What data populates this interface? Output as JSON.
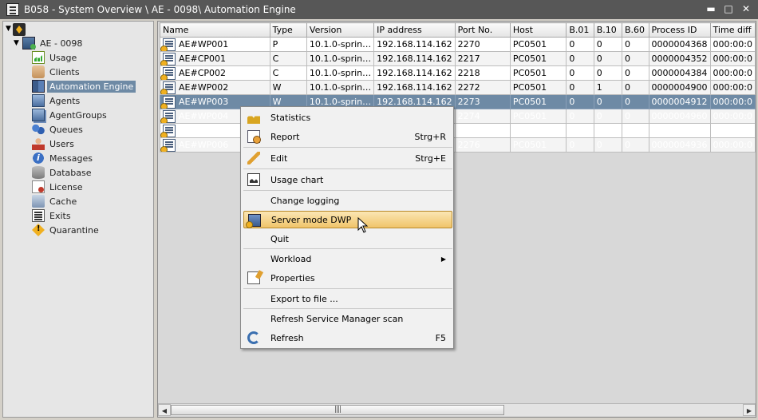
{
  "window": {
    "title": "B058 - System Overview \\ AE - 0098\\ Automation Engine",
    "minimize_glyph": "▬",
    "maximize_glyph": "□",
    "close_glyph": "✕"
  },
  "tree": {
    "root_expander": "▼",
    "system_expander": "▼",
    "system_label": "AE - 0098",
    "items": [
      {
        "label": "Usage",
        "icon": "usage-icon"
      },
      {
        "label": "Clients",
        "icon": "clients-icon"
      },
      {
        "label": "Automation Engine",
        "icon": "automation-engine-icon",
        "selected": true
      },
      {
        "label": "Agents",
        "icon": "agents-icon"
      },
      {
        "label": "AgentGroups",
        "icon": "agentgroups-icon"
      },
      {
        "label": "Queues",
        "icon": "queues-icon"
      },
      {
        "label": "Users",
        "icon": "users-icon"
      },
      {
        "label": "Messages",
        "icon": "messages-icon"
      },
      {
        "label": "Database",
        "icon": "database-icon"
      },
      {
        "label": "License",
        "icon": "license-icon"
      },
      {
        "label": "Cache",
        "icon": "cache-icon"
      },
      {
        "label": "Exits",
        "icon": "exits-icon"
      },
      {
        "label": "Quarantine",
        "icon": "quarantine-icon"
      }
    ]
  },
  "grid": {
    "columns": [
      "Name",
      "Type",
      "Version",
      "IP address",
      "Port No.",
      "Host",
      "B.01",
      "B.10",
      "B.60",
      "Process ID",
      "Time diff"
    ],
    "rows": [
      [
        "AE#WP001",
        "P",
        "10.1.0-sprin…",
        "192.168.114.162",
        "2270",
        "PC0501",
        "0",
        "0",
        "0",
        "0000004368",
        "000:00:0"
      ],
      [
        "AE#CP001",
        "C",
        "10.1.0-sprin…",
        "192.168.114.162",
        "2217",
        "PC0501",
        "0",
        "0",
        "0",
        "0000004352",
        "000:00:0"
      ],
      [
        "AE#CP002",
        "C",
        "10.1.0-sprin…",
        "192.168.114.162",
        "2218",
        "PC0501",
        "0",
        "0",
        "0",
        "0000004384",
        "000:00:0"
      ],
      [
        "AE#WP002",
        "W",
        "10.1.0-sprin…",
        "192.168.114.162",
        "2272",
        "PC0501",
        "0",
        "1",
        "0",
        "0000004900",
        "000:00:0"
      ],
      [
        "AE#WP003",
        "W",
        "10.1.0-sprin…",
        "192.168.114.162",
        "2273",
        "PC0501",
        "0",
        "0",
        "0",
        "0000004912",
        "000:00:0"
      ],
      [
        "AE#WP004",
        "W",
        "10.1.0-sprin…",
        "192.168.114.162",
        "2274",
        "PC0501",
        "0",
        "0",
        "0",
        "0000004960",
        "000:00:0"
      ],
      [
        "AE#WP005",
        "W",
        "10.1.0-sprin…",
        "192.168.114.162",
        "2275",
        "PC0501",
        "0",
        "0",
        "0",
        "0000004948",
        "000:00:0"
      ],
      [
        "AE#WP006",
        "W",
        "10.1.0-sprin…",
        "192.168.114.162",
        "2276",
        "PC0501",
        "0",
        "0",
        "0",
        "0000004936",
        "000:00:0"
      ]
    ],
    "selected_row": 4,
    "scroll_left": "◀",
    "scroll_right": "▶",
    "scroll_grip": "||||"
  },
  "context_menu": {
    "items": [
      {
        "label": "Statistics",
        "shortcut": "",
        "icon": "statistics-icon"
      },
      {
        "label": "Report",
        "shortcut": "Strg+R",
        "icon": "report-icon"
      },
      {
        "label": "Edit",
        "shortcut": "Strg+E",
        "icon": "edit-icon"
      },
      {
        "label": "Usage chart",
        "shortcut": "",
        "icon": "usage-chart-icon"
      },
      {
        "label": "Change logging",
        "shortcut": "",
        "icon": ""
      },
      {
        "label": "Server mode DWP",
        "shortcut": "",
        "icon": "server-mode-icon",
        "highlighted": true
      },
      {
        "label": "Quit",
        "shortcut": "",
        "icon": ""
      },
      {
        "label": "Workload",
        "shortcut": "",
        "icon": "",
        "submenu": "▶"
      },
      {
        "label": "Properties",
        "shortcut": "",
        "icon": "properties-icon"
      },
      {
        "label": "Export to file ...",
        "shortcut": "",
        "icon": ""
      },
      {
        "label": "Refresh Service Manager scan",
        "shortcut": "",
        "icon": ""
      },
      {
        "label": "Refresh",
        "shortcut": "F5",
        "icon": "refresh-icon"
      }
    ]
  },
  "colors": {
    "titlebar": "#575757",
    "selection": "#6e8aa5",
    "menu_highlight": "#f0c46a"
  }
}
